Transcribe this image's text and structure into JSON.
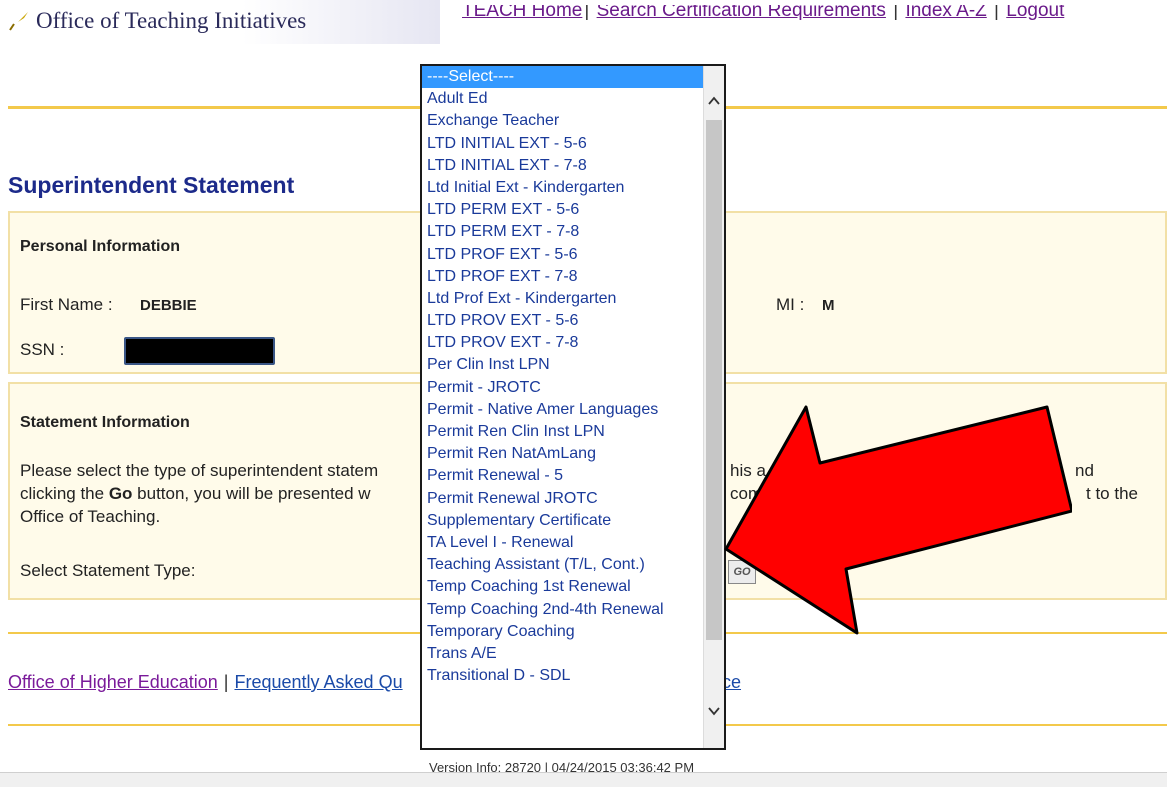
{
  "header": {
    "logo_text": "Office of Teaching Initiatives",
    "top_links": [
      "TEACH Home",
      "Search Certification Requirements",
      "Index A-Z",
      "Logout"
    ]
  },
  "page_title": "Superintendent Statement",
  "personal": {
    "heading": "Personal Information",
    "first_name_label": "First Name :",
    "first_name_value": "DEBBIE",
    "mi_label": "MI :",
    "mi_value": "M",
    "ssn_label": "SSN :"
  },
  "statement": {
    "heading": "Statement Information",
    "line1_a": "Please select the type of superintendent statem",
    "line1_b": "his a",
    "line1_c": "nd",
    "line2_a": "clicking the ",
    "line2_go": "Go",
    "line2_b": " button, you will be presented w",
    "line2_c": "com",
    "line2_d": "t to the",
    "line3": "Office of Teaching.",
    "select_label": "Select Statement Type:",
    "go_button": "GO"
  },
  "footer": {
    "link1": "Office of Higher Education",
    "link2": "Frequently Asked Qu",
    "tail": "ce",
    "version": "Version Info: 28720 | 04/24/2015 03:36:42 PM"
  },
  "dropdown": {
    "selected": "----Select----",
    "options": [
      "----Select----",
      "Adult Ed",
      "Exchange Teacher",
      "LTD INITIAL EXT - 5-6",
      "LTD INITIAL EXT - 7-8",
      "Ltd Initial Ext - Kindergarten",
      "LTD PERM EXT - 5-6",
      "LTD PERM EXT - 7-8",
      "LTD PROF EXT - 5-6",
      "LTD PROF EXT - 7-8",
      "Ltd Prof Ext - Kindergarten",
      "LTD PROV EXT - 5-6",
      "LTD PROV EXT - 7-8",
      "Per Clin Inst LPN",
      "Permit - JROTC",
      "Permit - Native Amer Languages",
      "Permit Ren Clin Inst LPN",
      "Permit Ren NatAmLang",
      "Permit Renewal - 5",
      "Permit Renewal JROTC",
      "Supplementary Certificate",
      "TA Level I - Renewal",
      "Teaching Assistant (T/L, Cont.)",
      "Temp Coaching 1st Renewal",
      "Temp Coaching 2nd-4th Renewal",
      "Temporary Coaching",
      "Trans A/E",
      "Transitional D - SDL"
    ]
  },
  "colors": {
    "gold": "#f3c94b",
    "title_blue": "#1c2a8a",
    "link_blue": "#1a4aa8",
    "select_highlight": "#3399ff",
    "annotation_red": "#ff0000"
  }
}
